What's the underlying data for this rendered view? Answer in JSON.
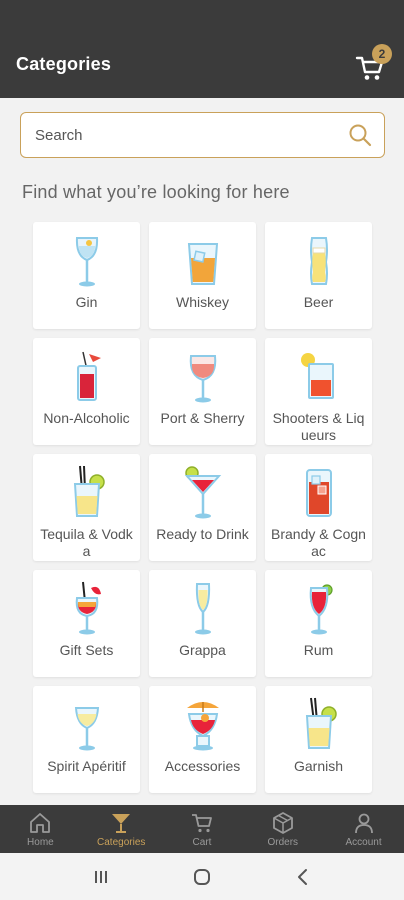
{
  "header": {
    "title": "Categories",
    "cart_count": "2"
  },
  "search": {
    "placeholder": "Search"
  },
  "subtitle": "Find what you’re looking for here",
  "categories": [
    {
      "label": "Gin",
      "icon": "gin-glass-icon"
    },
    {
      "label": "Whiskey",
      "icon": "whiskey-glass-icon"
    },
    {
      "label": "Beer",
      "icon": "beer-glass-icon"
    },
    {
      "label": "Non-Alcoholic",
      "icon": "non-alcoholic-drink-icon"
    },
    {
      "label": "Port & Sherry",
      "icon": "port-wine-glass-icon"
    },
    {
      "label": "Shooters & Liqueurs",
      "icon": "shooter-glass-icon"
    },
    {
      "label": "Tequila & Vodka",
      "icon": "tequila-glass-icon"
    },
    {
      "label": "Ready to Drink",
      "icon": "cocktail-glass-icon"
    },
    {
      "label": "Brandy & Cognac",
      "icon": "brandy-glass-icon"
    },
    {
      "label": "Gift Sets",
      "icon": "gift-cocktail-icon"
    },
    {
      "label": "Grappa",
      "icon": "champagne-flute-icon"
    },
    {
      "label": "Rum",
      "icon": "rum-cocktail-icon"
    },
    {
      "label": "Spirit Apéritif",
      "icon": "aperitif-glass-icon"
    },
    {
      "label": "Accessories",
      "icon": "accessories-cocktail-icon"
    },
    {
      "label": "Garnish",
      "icon": "garnish-glass-icon"
    }
  ],
  "nav": [
    {
      "label": "Home",
      "icon": "home-icon"
    },
    {
      "label": "Categories",
      "icon": "cocktail-icon"
    },
    {
      "label": "Cart",
      "icon": "cart-icon"
    },
    {
      "label": "Orders",
      "icon": "box-icon"
    },
    {
      "label": "Account",
      "icon": "user-icon"
    }
  ],
  "colors": {
    "header_bg": "#3b3b3b",
    "accent": "#c9a15a",
    "page_bg": "#f2f2f2"
  }
}
